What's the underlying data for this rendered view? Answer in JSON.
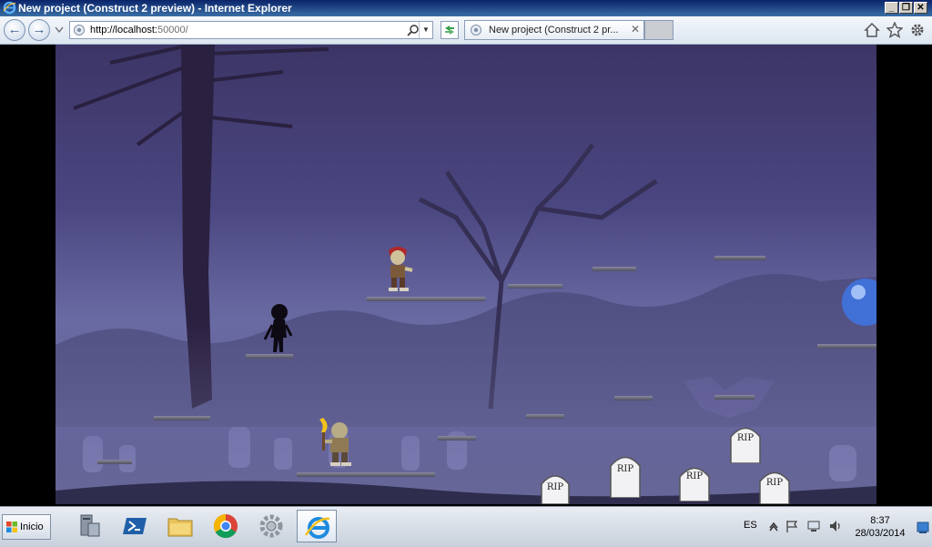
{
  "window": {
    "title": "New project (Construct 2 preview) - Internet Explorer",
    "controls": [
      "_",
      "❐",
      "✕"
    ]
  },
  "navbar": {
    "back_glyph": "←",
    "forward_glyph": "→",
    "url_host": "http://localhost:",
    "url_rest": "50000/",
    "tab_label": "New project (Construct 2 pr...",
    "tab_close": "✕"
  },
  "game": {
    "tombstone_label": "RIP"
  },
  "taskbar": {
    "start_label": "Inicio",
    "language": "ES",
    "time": "8:37",
    "date": "28/03/2014"
  }
}
